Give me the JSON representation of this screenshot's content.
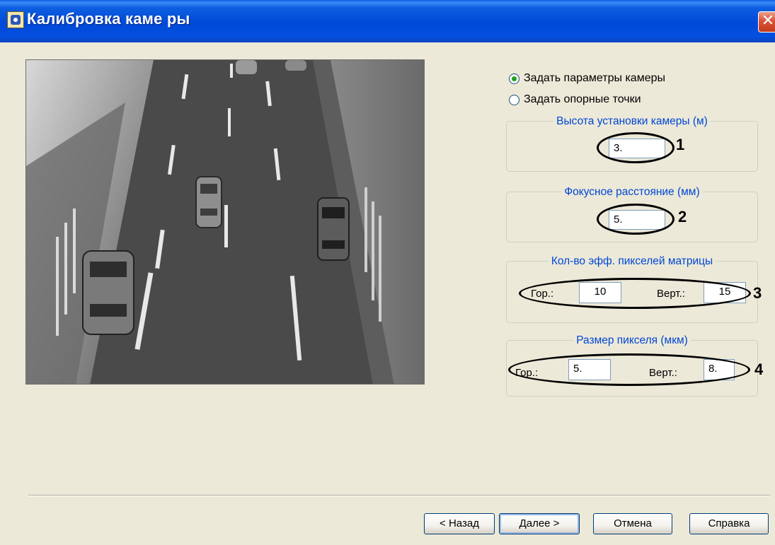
{
  "window": {
    "title": "Калибровка каме ры",
    "close_glyph": "✕"
  },
  "camera_view": {
    "description_icon": "camera-road-feed"
  },
  "mode": {
    "set_camera_params": "Задать параметры камеры",
    "set_reference_points": "Задать опорные точки",
    "selected": "set_camera_params"
  },
  "height_group": {
    "title": "Высота установки камеры (м)",
    "value": "3.",
    "callout": "1"
  },
  "focal_group": {
    "title": "Фокусное расстояние (мм)",
    "value": "5.",
    "callout": "2"
  },
  "matrix_group": {
    "title": "Кол-во эфф. пикселей матрицы",
    "hor_label": "Гор.:",
    "hor_value": "10",
    "vert_label": "Верт.:",
    "vert_value": "15",
    "callout": "3"
  },
  "pixel_group": {
    "title": "Размер пикселя (мкм)",
    "hor_label": "Гор.:",
    "hor_value": "5.",
    "vert_label": "Верт.:",
    "vert_value": "8.",
    "callout": "4"
  },
  "buttons": {
    "back": "< Назад",
    "next": "Далее >",
    "cancel": "Отмена",
    "help": "Справка"
  },
  "colors": {
    "titlebar": "#0054e3",
    "group_title": "#0046d5",
    "background": "#ece9d8",
    "close": "#d9543a"
  }
}
